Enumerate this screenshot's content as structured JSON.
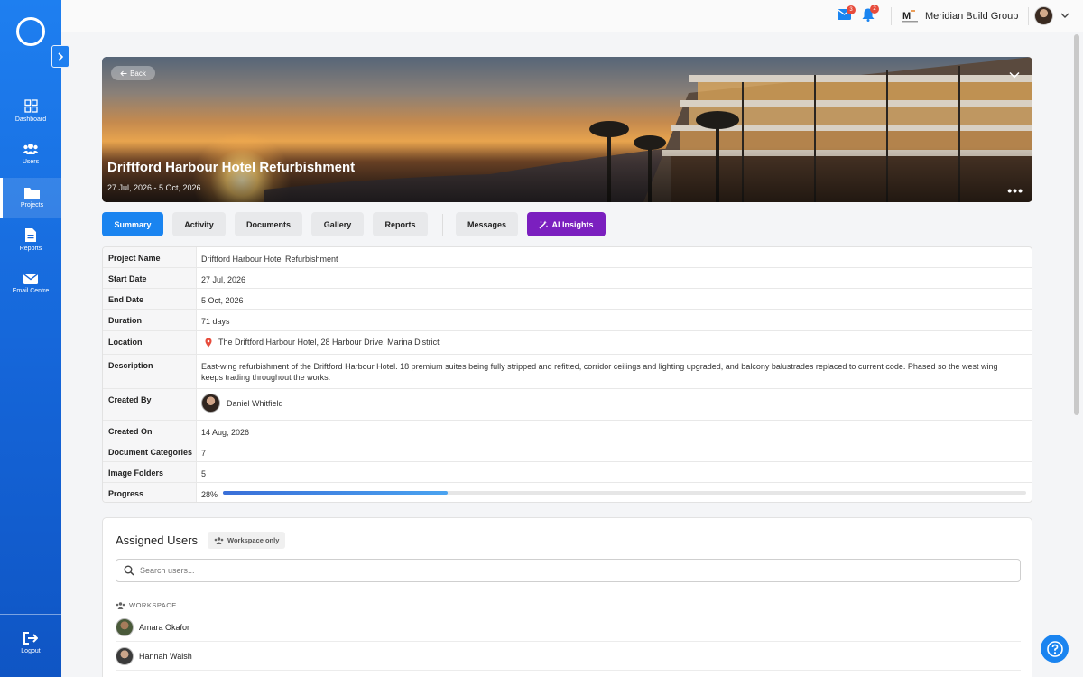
{
  "sidebar": {
    "items": [
      {
        "label": "Dashboard",
        "icon": "dashboard-icon"
      },
      {
        "label": "Users",
        "icon": "users-icon"
      },
      {
        "label": "Projects",
        "icon": "folder-icon",
        "active": true
      },
      {
        "label": "Reports",
        "icon": "report-icon"
      },
      {
        "label": "Email Centre",
        "icon": "mail-icon"
      }
    ],
    "logout_label": "Logout"
  },
  "topbar": {
    "mail_count": "3",
    "notification_count": "2",
    "company_name": "Meridian Build Group",
    "company_logo_text": "M"
  },
  "hero": {
    "back_label": "Back",
    "title": "Driftford Harbour Hotel Refurbishment",
    "dates": "27 Jul, 2026 - 5 Oct, 2026",
    "more_label": "•••"
  },
  "tabs": [
    {
      "label": "Summary",
      "active": true
    },
    {
      "label": "Activity"
    },
    {
      "label": "Documents"
    },
    {
      "label": "Gallery"
    },
    {
      "label": "Reports"
    },
    {
      "label": "Messages"
    },
    {
      "label": "AI Insights",
      "icon": "magic-wand-icon"
    }
  ],
  "details": {
    "project_name_label": "Project Name",
    "project_name": "Driftford Harbour Hotel Refurbishment",
    "start_date_label": "Start Date",
    "start_date": "27 Jul, 2026",
    "end_date_label": "End Date",
    "end_date": "5 Oct, 2026",
    "duration_label": "Duration",
    "duration": "71 days",
    "location_label": "Location",
    "location": "The Driftford Harbour Hotel, 28 Harbour Drive, Marina District",
    "description_label": "Description",
    "description": "East-wing refurbishment of the Driftford Harbour Hotel. 18 premium suites being fully stripped and refitted, corridor ceilings and lighting upgraded, and balcony balustrades replaced to current code. Phased so the west wing keeps trading throughout the works.",
    "created_by_label": "Created By",
    "created_by": "Daniel Whitfield",
    "created_on_label": "Created On",
    "created_on": "14 Aug, 2026",
    "doc_categories_label": "Document Categories",
    "doc_categories": "7",
    "image_folders_label": "Image Folders",
    "image_folders": "5",
    "progress_label": "Progress",
    "progress_text": "28%",
    "progress_fraction": 0.28
  },
  "assigned_users": {
    "title": "Assigned Users",
    "badge": "Workspace only",
    "search_placeholder": "Search users...",
    "group_label": "WORKSPACE",
    "users": [
      "Amara Okafor",
      "Hannah Walsh"
    ]
  },
  "colors": {
    "primary": "#1a84f0",
    "ai_purple": "#7b1fbf",
    "badge_red": "#e74c3c",
    "location_pin": "#e74c3c"
  }
}
